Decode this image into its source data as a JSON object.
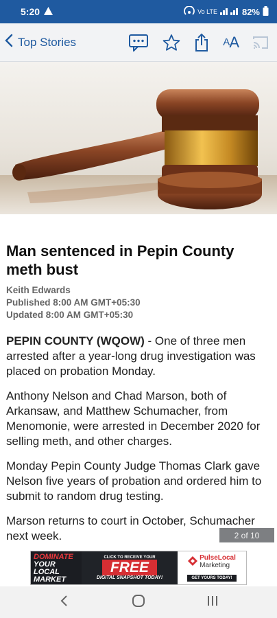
{
  "status_bar": {
    "time": "5:20",
    "battery": "82%",
    "network": "Vo LTE"
  },
  "nav": {
    "back_label": "Top Stories",
    "icons": [
      "comments-icon",
      "star-icon",
      "share-icon",
      "text-size-icon",
      "cast-icon"
    ],
    "text_size_label": "A",
    "text_size_label_large": "A"
  },
  "hero": {
    "description_icon": "gavel-image"
  },
  "article": {
    "headline": "Man sentenced in Pepin County meth bust",
    "author": "Keith Edwards",
    "published": "Published 8:00 AM GMT+05:30",
    "updated": "Updated 8:00 AM GMT+05:30",
    "dateline": "PEPIN COUNTY (WQOW)",
    "paragraph_1_rest": " - One of three men arrested after a year-long drug investigation was placed on probation Monday.",
    "paragraph_2": "Anthony Nelson and Chad Marson, both of Arkansaw, and Matthew Schumacher, from Menomonie, were arrested in December 2020 for selling meth, and other charges.",
    "paragraph_3": "Monday Pepin County Judge Thomas Clark gave Nelson five years of probation and ordered him to submit to random drug testing.",
    "paragraph_4": "Marson returns to court in October, Schumacher next week."
  },
  "page_indicator": "2 of 10",
  "ad": {
    "line_1": "DOMINATE",
    "line_2": "YOUR",
    "line_3": "LOCAL",
    "line_4": "MARKET",
    "click_text": "CLICK TO RECEIVE YOUR",
    "free_text": "FREE",
    "snapshot_text": "DIGITAL SNAPSHOT TODAY!",
    "brand_1": "PulseLocal",
    "brand_2": "Marketing",
    "cta": "GET YOURS TODAY!"
  },
  "colors": {
    "accent": "#1f5aa0",
    "nav_bg": "#f2f3f5",
    "indicator_bg": "#7d7f82"
  }
}
